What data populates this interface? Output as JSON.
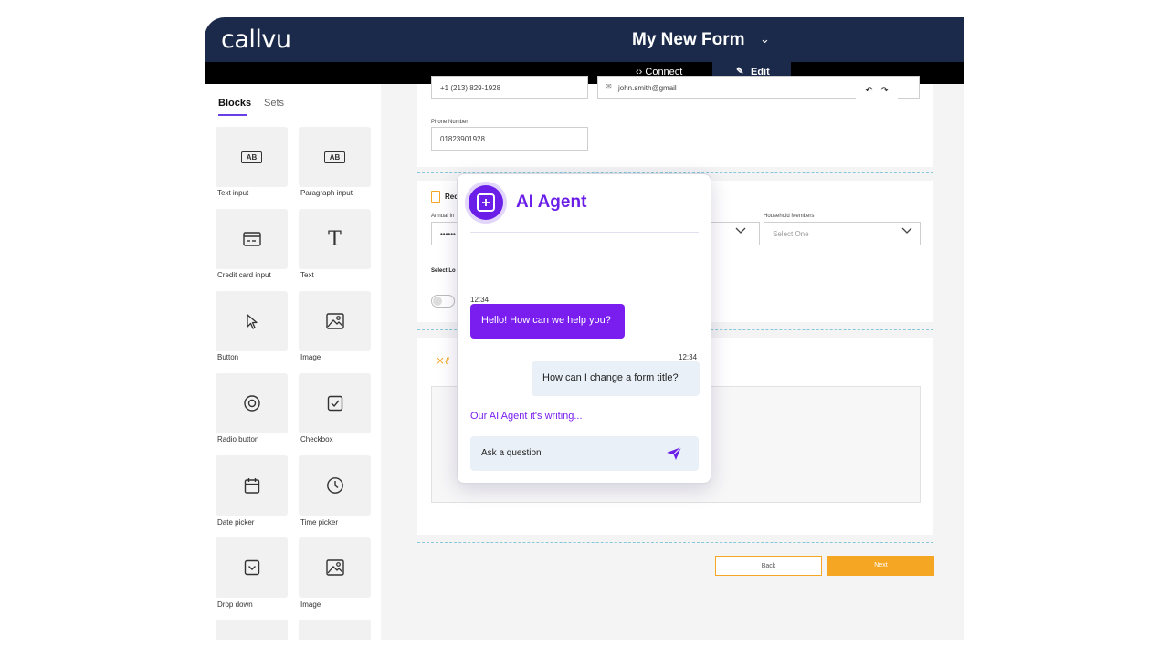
{
  "header": {
    "logo": "callvu",
    "form_title": "My New Form",
    "title_chevron": "⌄"
  },
  "modes": {
    "connect": "‹› Connect",
    "edit": "Edit"
  },
  "toolbar": {
    "undo": "↶",
    "redo": "↷"
  },
  "sidebar": {
    "tabs": [
      {
        "label": "Blocks",
        "active": true
      },
      {
        "label": "Sets",
        "active": false
      }
    ],
    "blocks": [
      {
        "label": "Text input",
        "icon": "text-input-icon"
      },
      {
        "label": "Paragraph input",
        "icon": "paragraph-input-icon"
      },
      {
        "label": "Credit card input",
        "icon": "credit-card-icon"
      },
      {
        "label": "Text",
        "icon": "text-icon"
      },
      {
        "label": "Button",
        "icon": "cursor-icon"
      },
      {
        "label": "Image",
        "icon": "image-icon"
      },
      {
        "label": "Radio button",
        "icon": "radio-icon"
      },
      {
        "label": "Checkbox",
        "icon": "checkbox-icon"
      },
      {
        "label": "Date picker",
        "icon": "calendar-icon"
      },
      {
        "label": "Time picker",
        "icon": "clock-icon"
      },
      {
        "label": "Drop down",
        "icon": "dropdown-icon"
      },
      {
        "label": "Image",
        "icon": "image-icon"
      }
    ],
    "ab_text": "AB"
  },
  "form": {
    "phone_top": "+1 (213) 829-1928",
    "email_value": "john.smith@gmail",
    "phone_label": "Phone Number",
    "phone_value": "01823901928",
    "section_title": "Rec",
    "annual_label": "Annual In",
    "annual_value": "••••••",
    "household_label": "Household Members",
    "household_placeholder": "Select One",
    "select_label": "Select Lo",
    "back_label": "Back",
    "next_label": "Next"
  },
  "ai_agent": {
    "title": "AI Agent",
    "messages": [
      {
        "from": "agent",
        "time": "12:34",
        "text": "Hello! How can we help you?"
      },
      {
        "from": "user",
        "time": "12:34",
        "text": "How can I change a form title?"
      }
    ],
    "status": "Our AI Agent it's writing...",
    "input_placeholder": "Ask a question"
  },
  "colors": {
    "header": "#1b2a4a",
    "accent_purple": "#6a1ee8",
    "next_orange": "#f5a623",
    "dash_blue": "#86c7da"
  }
}
